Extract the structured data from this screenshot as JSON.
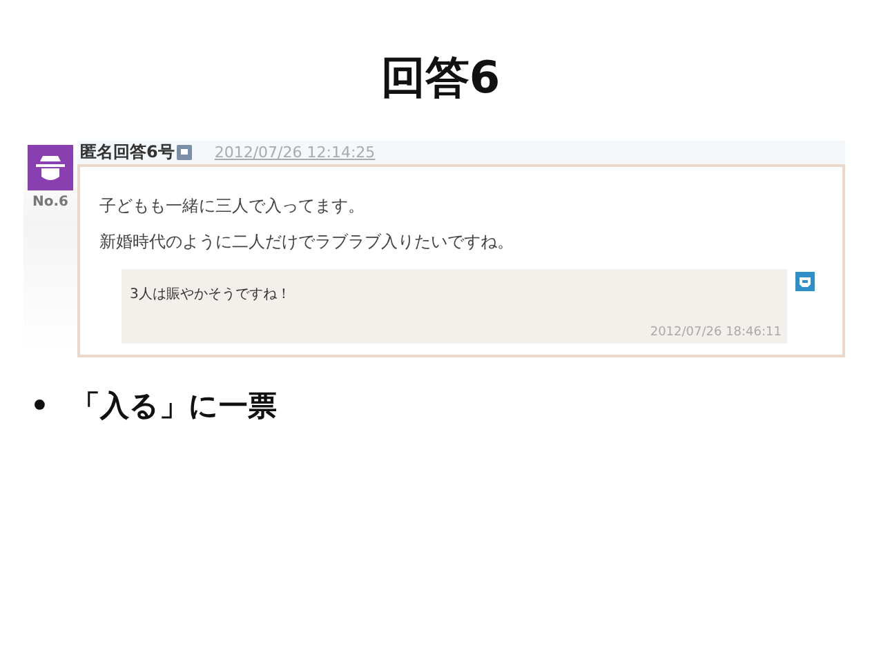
{
  "slide_title": "回答6",
  "post": {
    "author": "匿名回答6号",
    "posted_at": "2012/07/26 12:14:25",
    "number": "No.6",
    "body": [
      "子どもも一緒に三人で入ってます。",
      "新婚時代のように二人だけでラブラブ入りたいですね。"
    ],
    "reply": {
      "text": "3人は賑やかそうですね！",
      "replied_at": "2012/07/26 18:46:11"
    }
  },
  "bullets": [
    {
      "marker": "•",
      "text": "「入る」に一票"
    }
  ]
}
